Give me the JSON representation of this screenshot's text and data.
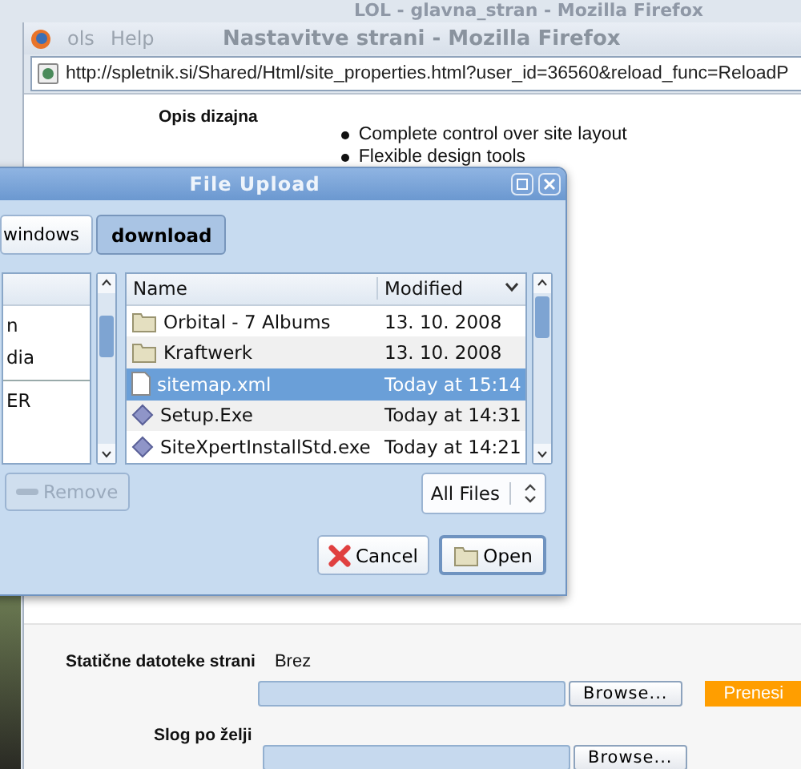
{
  "background_window": {
    "title": "LOL - glavna_stran - Mozilla Firefox"
  },
  "browser": {
    "menu": [
      "ols",
      "Help"
    ],
    "title": "Nastavitve strani - Mozilla Firefox",
    "url": "http://spletnik.si/Shared/Html/site_properties.html?user_id=36560&reload_func=ReloadP"
  },
  "page": {
    "design": {
      "label": "Opis dizajna",
      "bullets": [
        "Complete control over site layout",
        "Flexible design tools"
      ]
    },
    "static_files": {
      "label": "Statične datoteke strani",
      "value": "Brez",
      "browse": "Browse...",
      "upload": "Prenesi"
    },
    "custom_style": {
      "label": "Slog po želji",
      "browse": "Browse..."
    }
  },
  "dialog": {
    "title": "File Upload",
    "path": [
      {
        "label": "windows",
        "selected": false
      },
      {
        "label": "download",
        "selected": true
      }
    ],
    "places": [
      [
        "n",
        "dia"
      ],
      [
        "ER"
      ]
    ],
    "columns": [
      "Name",
      "Modified"
    ],
    "files": [
      {
        "name": "Orbital - 7 Albums",
        "modified": "13. 10. 2008",
        "kind": "folder",
        "selected": false
      },
      {
        "name": "Kraftwerk",
        "modified": "13. 10. 2008",
        "kind": "folder",
        "selected": false
      },
      {
        "name": "sitemap.xml",
        "modified": "Today at 15:14",
        "kind": "document",
        "selected": true
      },
      {
        "name": "Setup.Exe",
        "modified": "Today at 14:31",
        "kind": "program",
        "selected": false
      },
      {
        "name": "SiteXpertInstallStd.exe",
        "modified": "Today at 14:21",
        "kind": "program",
        "selected": false
      }
    ],
    "remove": {
      "label": "Remove",
      "disabled": true
    },
    "filter": "All Files",
    "buttons": [
      {
        "label": "Cancel",
        "kind": "cancel"
      },
      {
        "label": "Open",
        "kind": "open"
      }
    ]
  }
}
